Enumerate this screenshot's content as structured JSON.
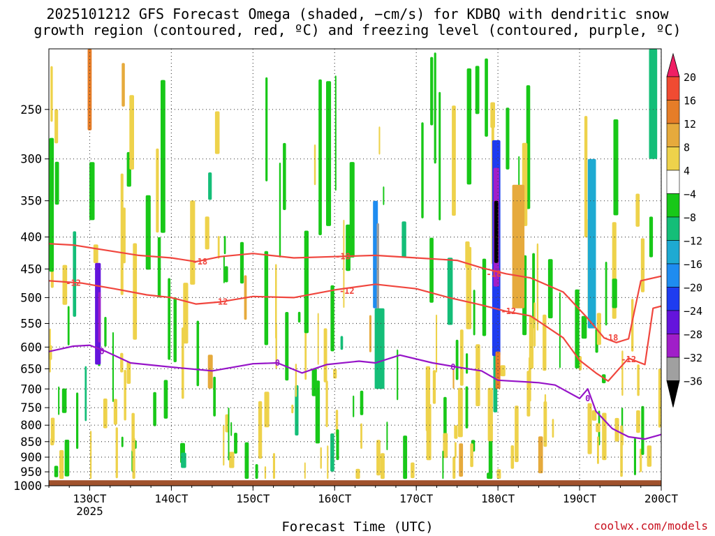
{
  "title_line1": "2025101212 GFS Forecast Omega (shaded, −cm/s) for KDBQ with dendritic snow",
  "title_line2": "growth region (contoured, red, ºC) and freezing level (contoured, purple, ºC)",
  "xlabel": "Forecast Time (UTC)",
  "credit": "coolwx.com/models",
  "colors": {
    "dgz_line": "#f0463e",
    "freezing_line": "#9614c8",
    "ground": "#a0522d",
    "grid": "#444444"
  },
  "chart_data": {
    "type": "heatmap",
    "title": "2025101212 GFS Forecast Omega (shaded, −cm/s) for KDBQ with dendritic snow growth region (contoured, red, ºC) and freezing level (contoured, purple, ºC)",
    "xlabel": "Forecast Time (UTC)",
    "ylabel": "",
    "x_ticks": [
      "130CT",
      "140CT",
      "150CT",
      "160CT",
      "170CT",
      "180CT",
      "190CT",
      "200CT"
    ],
    "x_subtick": "2025",
    "xlim": [
      12.5,
      20.0
    ],
    "y_ticks": [
      250,
      300,
      350,
      400,
      450,
      500,
      550,
      600,
      650,
      700,
      750,
      800,
      850,
      900,
      950,
      1000
    ],
    "ylim_hpa": [
      200,
      1000
    ],
    "y_scale": "log",
    "colorbar": {
      "labels": [
        "20",
        "16",
        "12",
        "8",
        "4",
        "−4",
        "−8",
        "−12",
        "−16",
        "−20",
        "−24",
        "−28",
        "−32",
        "−36"
      ],
      "colors": [
        "#f01e64",
        "#f04b32",
        "#e67d28",
        "#e6aa3c",
        "#eed24b",
        "#ffffff",
        "#18c818",
        "#14be78",
        "#1eaad2",
        "#1e8cf0",
        "#1e3cf0",
        "#6414dc",
        "#a01ec8",
        "#a0a0a0",
        "#000000"
      ]
    },
    "contours": [
      {
        "name": "-18",
        "color": "#f0463e",
        "points": [
          [
            12.5,
            410
          ],
          [
            12.8,
            412
          ],
          [
            13.2,
            420
          ],
          [
            13.6,
            428
          ],
          [
            14.0,
            432
          ],
          [
            14.3,
            438
          ],
          [
            14.6,
            430
          ],
          [
            15.0,
            425
          ],
          [
            15.5,
            432
          ],
          [
            16.0,
            430
          ],
          [
            16.5,
            428
          ],
          [
            17.0,
            432
          ],
          [
            17.5,
            436
          ],
          [
            17.8,
            448
          ],
          [
            18.1,
            458
          ],
          [
            18.4,
            465
          ],
          [
            18.8,
            490
          ],
          [
            19.1,
            540
          ],
          [
            19.3,
            580
          ],
          [
            19.45,
            590
          ],
          [
            19.6,
            582
          ],
          [
            19.75,
            470
          ],
          [
            20.0,
            462
          ]
        ]
      },
      {
        "name": "-12",
        "color": "#f0463e",
        "points": [
          [
            12.5,
            470
          ],
          [
            12.9,
            474
          ],
          [
            13.3,
            484
          ],
          [
            13.7,
            495
          ],
          [
            14.0,
            500
          ],
          [
            14.3,
            512
          ],
          [
            14.6,
            508
          ],
          [
            15.0,
            498
          ],
          [
            15.5,
            500
          ],
          [
            16.0,
            486
          ],
          [
            16.5,
            476
          ],
          [
            17.0,
            484
          ],
          [
            17.4,
            500
          ],
          [
            17.8,
            514
          ],
          [
            18.1,
            526
          ],
          [
            18.4,
            535
          ],
          [
            18.8,
            580
          ],
          [
            19.0,
            630
          ],
          [
            19.2,
            660
          ],
          [
            19.35,
            680
          ],
          [
            19.6,
            625
          ],
          [
            19.8,
            640
          ],
          [
            19.9,
            520
          ],
          [
            20.0,
            516
          ]
        ]
      },
      {
        "name": "0",
        "color": "#9614c8",
        "points": [
          [
            12.5,
            610
          ],
          [
            12.8,
            598
          ],
          [
            13.0,
            596
          ],
          [
            13.2,
            610
          ],
          [
            13.5,
            636
          ],
          [
            14.0,
            646
          ],
          [
            14.5,
            655
          ],
          [
            15.0,
            638
          ],
          [
            15.3,
            636
          ],
          [
            15.6,
            660
          ],
          [
            15.9,
            640
          ],
          [
            16.3,
            632
          ],
          [
            16.5,
            636
          ],
          [
            16.8,
            618
          ],
          [
            17.2,
            636
          ],
          [
            17.5,
            646
          ],
          [
            17.8,
            655
          ],
          [
            18.0,
            678
          ],
          [
            18.5,
            684
          ],
          [
            18.7,
            690
          ],
          [
            19.0,
            725
          ],
          [
            19.1,
            700
          ],
          [
            19.2,
            760
          ],
          [
            19.4,
            810
          ],
          [
            19.6,
            835
          ],
          [
            19.8,
            842
          ],
          [
            20.0,
            828
          ]
        ]
      }
    ],
    "contour_labels": [
      {
        "text": "-18",
        "x": 14.35,
        "p": 438
      },
      {
        "text": "-18",
        "x": 16.1,
        "p": 430
      },
      {
        "text": "-18",
        "x": 17.95,
        "p": 458
      },
      {
        "text": "-18",
        "x": 19.38,
        "p": 580
      },
      {
        "text": "-12",
        "x": 12.8,
        "p": 474
      },
      {
        "text": "-12",
        "x": 14.6,
        "p": 508
      },
      {
        "text": "-12",
        "x": 16.15,
        "p": 488
      },
      {
        "text": "-12",
        "x": 18.13,
        "p": 526
      },
      {
        "text": "-12",
        "x": 19.6,
        "p": 628
      },
      {
        "text": "0",
        "x": 13.15,
        "p": 610
      },
      {
        "text": "0",
        "x": 15.3,
        "p": 636
      },
      {
        "text": "0",
        "x": 17.45,
        "p": 646
      },
      {
        "text": "0",
        "x": 19.1,
        "p": 725
      }
    ],
    "omega_features": [
      {
        "x": 13.1,
        "p1": 440,
        "p2": 640,
        "w": 0.07,
        "v": -24
      },
      {
        "x": 13.12,
        "p1": 490,
        "p2": 590,
        "w": 0.03,
        "v": -30
      },
      {
        "x": 13.0,
        "p1": 200,
        "p2": 270,
        "w": 0.05,
        "v": 14
      },
      {
        "x": 16.5,
        "p1": 350,
        "p2": 520,
        "w": 0.06,
        "v": -18
      },
      {
        "x": 16.53,
        "p1": 380,
        "p2": 560,
        "w": 0.03,
        "v": -32
      },
      {
        "x": 16.55,
        "p1": 520,
        "p2": 700,
        "w": 0.12,
        "v": -10
      },
      {
        "x": 17.98,
        "p1": 280,
        "p2": 620,
        "w": 0.1,
        "v": -20
      },
      {
        "x": 17.98,
        "p1": 310,
        "p2": 480,
        "w": 0.07,
        "v": -30
      },
      {
        "x": 17.98,
        "p1": 350,
        "p2": 440,
        "w": 0.05,
        "v": -40
      },
      {
        "x": 18.25,
        "p1": 330,
        "p2": 520,
        "w": 0.15,
        "v": 8
      },
      {
        "x": 18.0,
        "p1": 610,
        "p2": 700,
        "w": 0.06,
        "v": 12
      },
      {
        "x": 19.15,
        "p1": 300,
        "p2": 560,
        "w": 0.1,
        "v": -14
      },
      {
        "x": 19.9,
        "p1": 200,
        "p2": 300,
        "w": 0.1,
        "v": -8
      }
    ],
    "surface": {
      "ground_top_hpa": 980
    }
  }
}
